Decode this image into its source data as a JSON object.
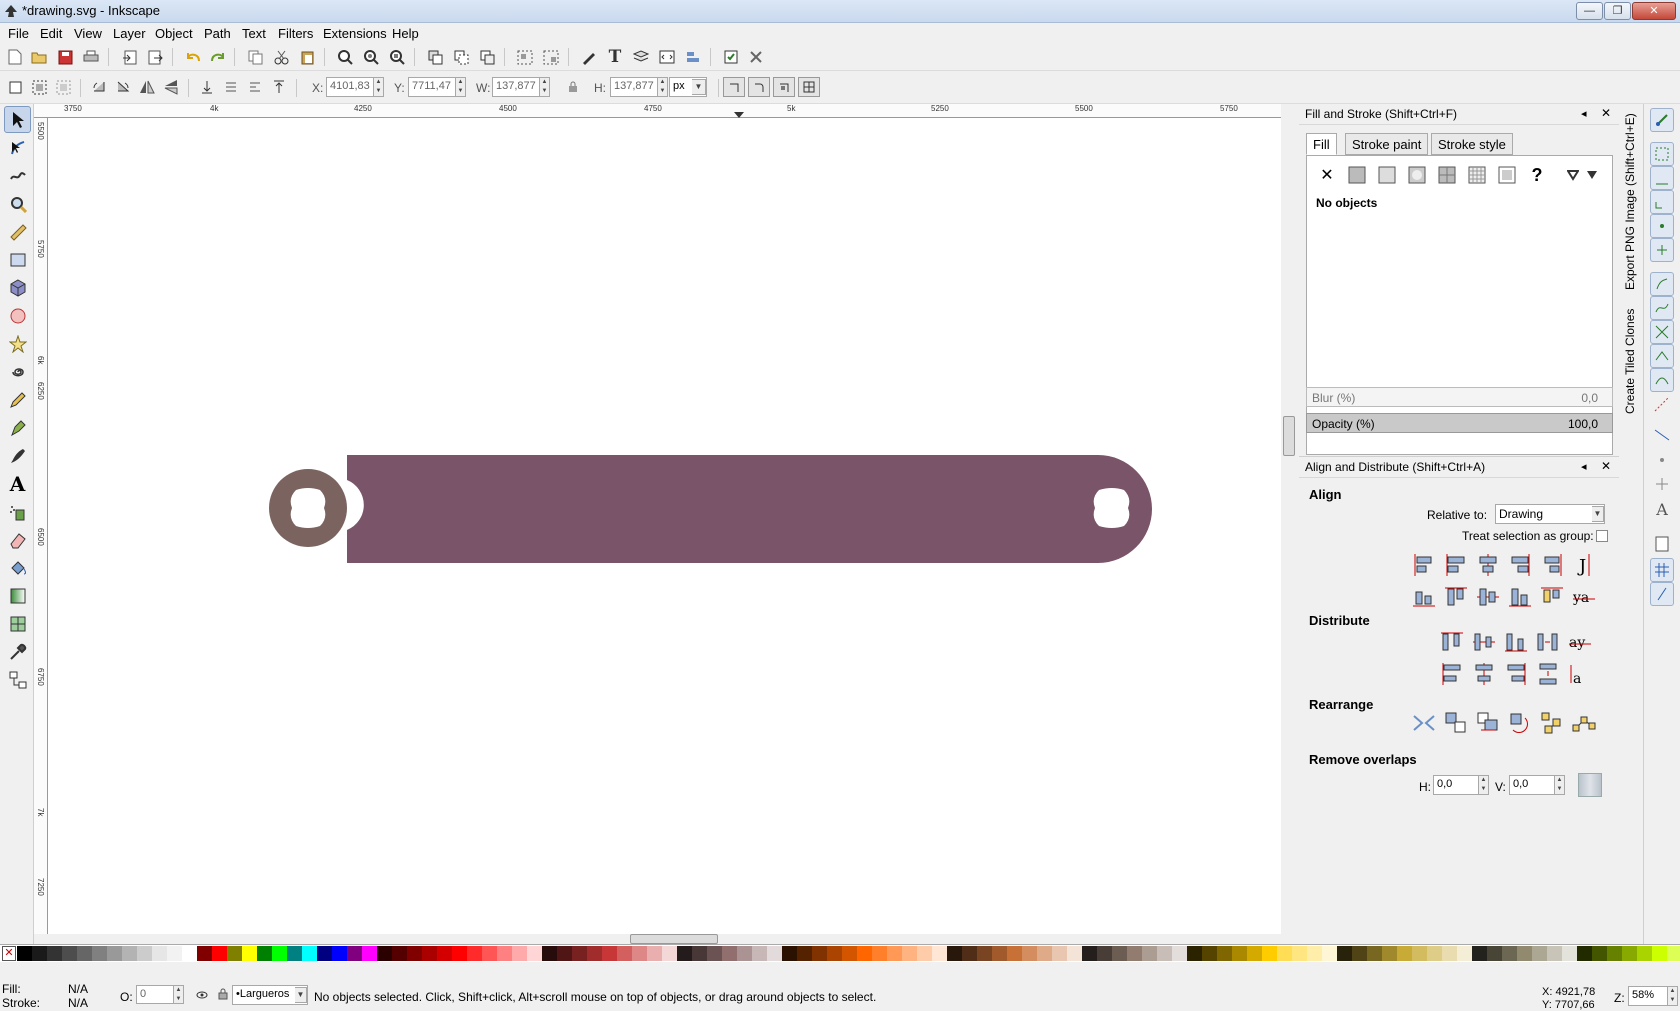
{
  "window": {
    "title": "*drawing.svg - Inkscape",
    "min": "—",
    "max": "❐",
    "close": "✕"
  },
  "menu": [
    "File",
    "Edit",
    "View",
    "Layer",
    "Object",
    "Path",
    "Text",
    "Filters",
    "Extensions",
    "Help"
  ],
  "toolctrl": {
    "x_label": "X:",
    "x_value": "4101,83",
    "y_label": "Y:",
    "y_value": "7711,47",
    "w_label": "W:",
    "w_value": "137,877",
    "h_label": "H:",
    "h_value": "137,877",
    "unit": "px"
  },
  "ruler": {
    "h_ticks": [
      "3750",
      "4k",
      "4250",
      "4500",
      "4750",
      "5k",
      "5250",
      "5500",
      "5750"
    ],
    "v_ticks": [
      "5500",
      "5750",
      "6k",
      "6250",
      "6500",
      "6750",
      "7k",
      "7250"
    ]
  },
  "fill_stroke": {
    "title": "Fill and Stroke (Shift+Ctrl+F)",
    "tabs": [
      "Fill",
      "Stroke paint",
      "Stroke style"
    ],
    "no_paint": "✕",
    "unknown": "?",
    "message": "No objects",
    "blur_label": "Blur (%)",
    "blur_value": "0,0",
    "opacity_label": "Opacity (%)",
    "opacity_value": "100,0"
  },
  "align": {
    "title": "Align and Distribute (Shift+Ctrl+A)",
    "section_align": "Align",
    "relative_label": "Relative to:",
    "relative_value": "Drawing",
    "treat_group": "Treat selection as group:",
    "section_distribute": "Distribute",
    "section_rearrange": "Rearrange",
    "section_overlaps": "Remove overlaps",
    "h_label": "H:",
    "h_value": "0,0",
    "v_label": "V:",
    "v_value": "0,0"
  },
  "vertical_tabs": [
    "Export PNG Image (Shift+Ctrl+E)",
    "Create Tiled Clones"
  ],
  "shape_color": "#7a5468",
  "circle_color": "#7b6460",
  "status": {
    "fill_label": "Fill:",
    "fill_value": "N/A",
    "stroke_label": "Stroke:",
    "stroke_value": "N/A",
    "o_label": "O:",
    "o_value": "0",
    "layer": "•Largueros",
    "message": "No objects selected. Click, Shift+click, Alt+scroll mouse on top of objects, or drag around objects to select.",
    "x_coord": "X: 4921,78",
    "y_coord": "Y: 7707,66",
    "z_label": "Z:",
    "zoom": "58%"
  },
  "palette": [
    "#000000",
    "#1a1a1a",
    "#333333",
    "#4d4d4d",
    "#666666",
    "#808080",
    "#999999",
    "#b3b3b3",
    "#cccccc",
    "#e6e6e6",
    "#f2f2f2",
    "#ffffff",
    "#800000",
    "#ff0000",
    "#808000",
    "#ffff00",
    "#008000",
    "#00ff00",
    "#008080",
    "#00ffff",
    "#000080",
    "#0000ff",
    "#800080",
    "#ff00ff",
    "#2b0000",
    "#550000",
    "#800000",
    "#aa0000",
    "#d40000",
    "#ff0000",
    "#ff2a2a",
    "#ff5555",
    "#ff8080",
    "#ffaaaa",
    "#ffd5d5",
    "#280b0b",
    "#501616",
    "#782121",
    "#a02c2c",
    "#c83737",
    "#d35f5f",
    "#de8787",
    "#e9afaf",
    "#f4d7d7",
    "#241c1c",
    "#483737",
    "#6c5353",
    "#916f6f",
    "#ac9393",
    "#c8b7b7",
    "#e3dbdb",
    "#2b1100",
    "#552200",
    "#803300",
    "#aa4400",
    "#d45500",
    "#ff6600",
    "#ff7f2a",
    "#ff9955",
    "#ffb380",
    "#ffccaa",
    "#ffe6d5",
    "#28170b",
    "#502d16",
    "#784421",
    "#a05a2c",
    "#c87137",
    "#d38d5f",
    "#deaa87",
    "#e9c6af",
    "#f4e3d7",
    "#241f1c",
    "#483e37",
    "#6c5d53",
    "#917c6f",
    "#ac9d93",
    "#c8beb7",
    "#e3dedb",
    "#2b2200",
    "#554400",
    "#806600",
    "#aa8800",
    "#d4aa00",
    "#ffcc00",
    "#ffdd55",
    "#ffe680",
    "#ffeeaa",
    "#fff6d5",
    "#28220b",
    "#504416",
    "#786721",
    "#a0892c",
    "#c8ab37",
    "#d3bc5f",
    "#decd87",
    "#e9ddaf",
    "#f4eed7",
    "#24221c",
    "#484537",
    "#6c6753",
    "#918a6f",
    "#aca793",
    "#c8c4b7",
    "#e3e2db",
    "#222b00",
    "#445500",
    "#668000",
    "#88aa00",
    "#aad400",
    "#ccff00",
    "#ddff55",
    "#e5ff80",
    "#eeffaa",
    "#f6ffd5"
  ]
}
